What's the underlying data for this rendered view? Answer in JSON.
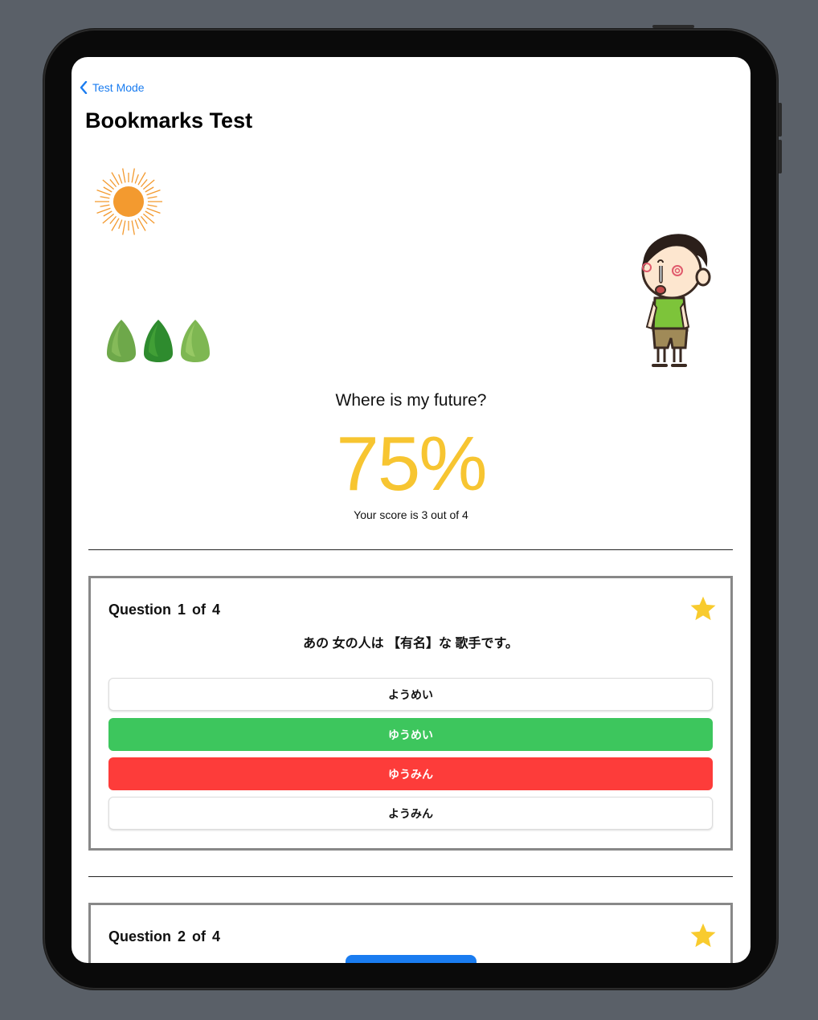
{
  "nav": {
    "back_label": "Test Mode",
    "title": "Bookmarks Test"
  },
  "result": {
    "message": "Where is my future?",
    "percent": "75%",
    "score_text": "Your score is 3 out of 4"
  },
  "questions": [
    {
      "header": "Question 1 of 4",
      "prompt": "あの 女の人は 【有名】な 歌手です。",
      "bookmarked": true,
      "options": [
        {
          "label": "ようめい",
          "state": "plain"
        },
        {
          "label": "ゆうめい",
          "state": "correct"
        },
        {
          "label": "ゆうみん",
          "state": "wrong"
        },
        {
          "label": "ようみん",
          "state": "plain"
        }
      ]
    },
    {
      "header": "Question 2 of 4",
      "bookmarked": true
    }
  ],
  "colors": {
    "accent": "#1a7cf0",
    "score": "#f7c531",
    "correct": "#3dc65d",
    "wrong": "#fd3c3a",
    "star": "#f8cb2e"
  },
  "icons": {
    "back": "chevron-left-icon",
    "bookmark": "star-icon"
  }
}
